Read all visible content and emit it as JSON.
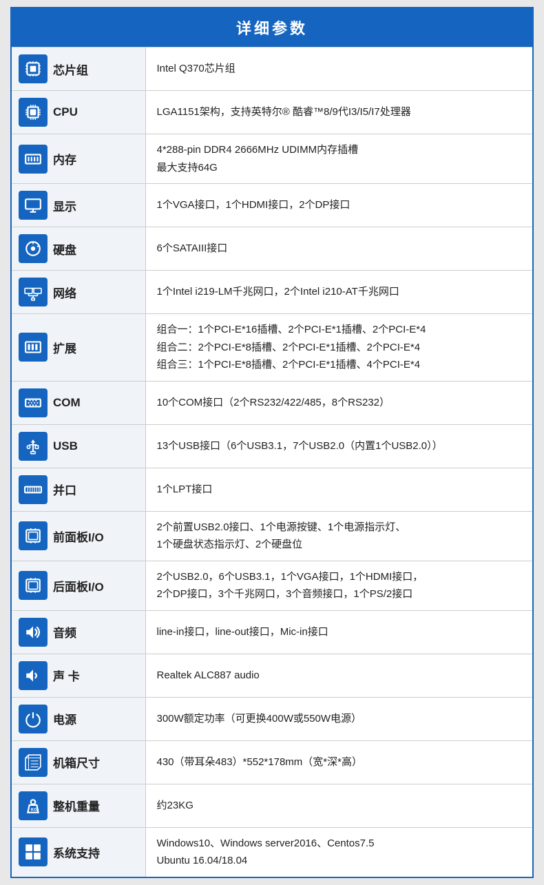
{
  "title": "详细参数",
  "rows": [
    {
      "id": "chipset",
      "label": "芯片组",
      "icon": "chipset",
      "value": "Intel Q370芯片组"
    },
    {
      "id": "cpu",
      "label": "CPU",
      "icon": "cpu",
      "value": "LGA1151架构，支持英特尔® 酷睿™8/9代I3/I5/I7处理器"
    },
    {
      "id": "memory",
      "label": "内存",
      "icon": "memory",
      "value": "4*288-pin DDR4 2666MHz UDIMM内存插槽\n最大支持64G"
    },
    {
      "id": "display",
      "label": "显示",
      "icon": "display",
      "value": "1个VGA接口，1个HDMI接口，2个DP接口"
    },
    {
      "id": "hdd",
      "label": "硬盘",
      "icon": "hdd",
      "value": "6个SATAIII接口"
    },
    {
      "id": "network",
      "label": "网络",
      "icon": "network",
      "value": "1个Intel i219-LM千兆网口，2个Intel i210-AT千兆网口"
    },
    {
      "id": "expansion",
      "label": "扩展",
      "icon": "expansion",
      "value": "组合一：1个PCI-E*16插槽、2个PCI-E*1插槽、2个PCI-E*4\n组合二：2个PCI-E*8插槽、2个PCI-E*1插槽、2个PCI-E*4\n组合三：1个PCI-E*8插槽、2个PCI-E*1插槽、4个PCI-E*4"
    },
    {
      "id": "com",
      "label": "COM",
      "icon": "com",
      "value": "10个COM接口（2个RS232/422/485，8个RS232）"
    },
    {
      "id": "usb",
      "label": "USB",
      "icon": "usb",
      "value": "13个USB接口（6个USB3.1，7个USB2.0（内置1个USB2.0））"
    },
    {
      "id": "parallel",
      "label": "并口",
      "icon": "parallel",
      "value": "1个LPT接口"
    },
    {
      "id": "front-io",
      "label": "前面板I/O",
      "icon": "front-io",
      "value": "2个前置USB2.0接口、1个电源按键、1个电源指示灯、\n1个硬盘状态指示灯、2个硬盘位"
    },
    {
      "id": "rear-io",
      "label": "后面板I/O",
      "icon": "rear-io",
      "value": "2个USB2.0，6个USB3.1，1个VGA接口，1个HDMI接口，\n2个DP接口，3个千兆网口，3个音频接口，1个PS/2接口"
    },
    {
      "id": "audio",
      "label": "音频",
      "icon": "audio",
      "value": "line-in接口，line-out接口，Mic-in接口"
    },
    {
      "id": "sound-card",
      "label": "声 卡",
      "icon": "sound-card",
      "value": "Realtek  ALC887 audio"
    },
    {
      "id": "power",
      "label": "电源",
      "icon": "power",
      "value": "300W额定功率（可更换400W或550W电源）"
    },
    {
      "id": "chassis",
      "label": "机箱尺寸",
      "icon": "chassis",
      "value": "430（带耳朵483）*552*178mm（宽*深*高）"
    },
    {
      "id": "weight",
      "label": "整机重量",
      "icon": "weight",
      "value": "约23KG"
    },
    {
      "id": "os",
      "label": "系统支持",
      "icon": "os",
      "value": "Windows10、Windows server2016、Centos7.5\nUbuntu 16.04/18.04"
    }
  ]
}
